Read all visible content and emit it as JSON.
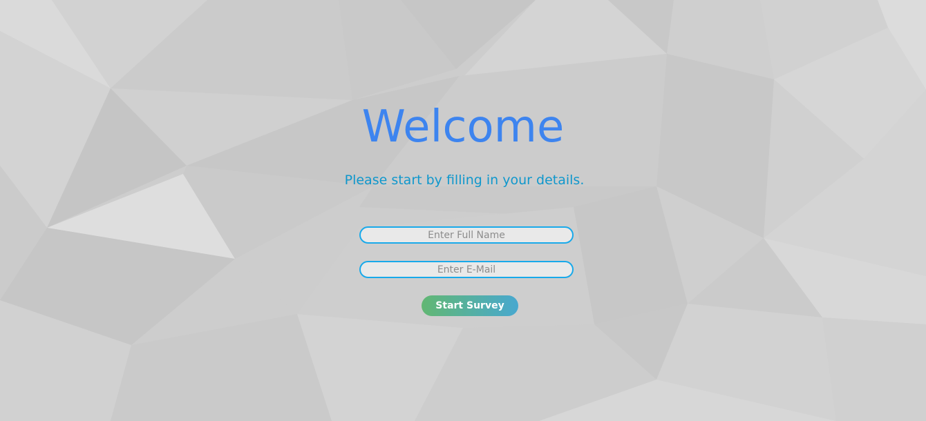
{
  "page": {
    "title": "Welcome",
    "subtitle": "Please start by filling in your details."
  },
  "form": {
    "name_placeholder": "Enter Full Name",
    "name_value": "",
    "email_placeholder": "Enter E-Mail",
    "email_value": "",
    "submit_label": "Start Survey"
  },
  "colors": {
    "title": "#3d84ef",
    "subtitle": "#0f97cc",
    "input_border": "#18a9ea",
    "button_gradient_start": "#62b773",
    "button_gradient_end": "#48a8cf",
    "background": "#cfcfcf"
  }
}
